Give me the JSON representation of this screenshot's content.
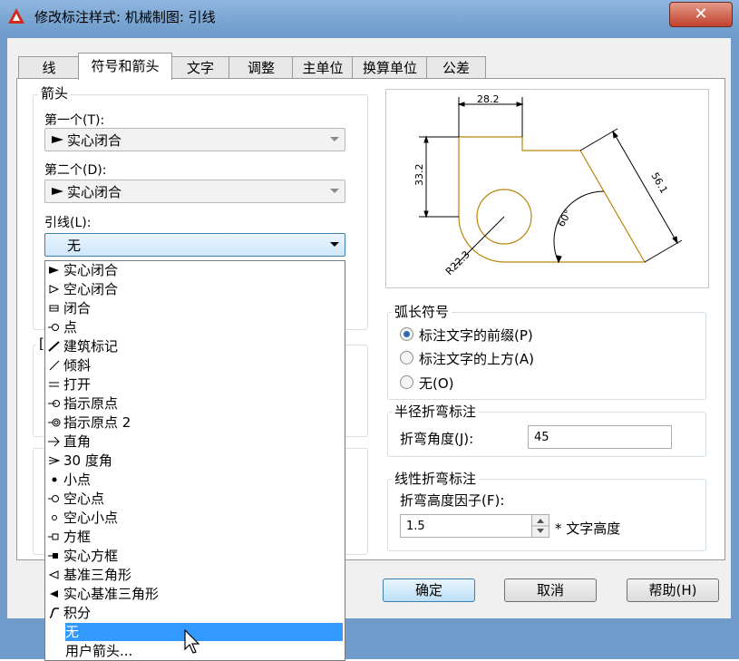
{
  "window": {
    "title": "修改标注样式: 机械制图: 引线",
    "close": "✕"
  },
  "tabs": [
    {
      "label": "线"
    },
    {
      "label": "符号和箭头"
    },
    {
      "label": "文字"
    },
    {
      "label": "调整"
    },
    {
      "label": "主单位"
    },
    {
      "label": "换算单位"
    },
    {
      "label": "公差"
    }
  ],
  "active_tab": "符号和箭头",
  "arrows": {
    "group_label": "箭头",
    "first_label": "第一个(T):",
    "first_value": "实心闭合",
    "second_label": "第二个(D):",
    "second_value": "实心闭合",
    "leader_label": "引线(L):",
    "leader_value": "无"
  },
  "dropdown": {
    "items": [
      {
        "label": "实心闭合",
        "icon": "solid-closed-arrow-icon"
      },
      {
        "label": "空心闭合",
        "icon": "hollow-closed-arrow-icon"
      },
      {
        "label": "闭合",
        "icon": "closed-arrow-icon"
      },
      {
        "label": "点",
        "icon": "dot-icon"
      },
      {
        "label": "建筑标记",
        "icon": "architectural-tick-icon"
      },
      {
        "label": "倾斜",
        "icon": "oblique-icon"
      },
      {
        "label": "打开",
        "icon": "open-arrow-icon"
      },
      {
        "label": "指示原点",
        "icon": "origin-indicator-icon"
      },
      {
        "label": "指示原点 2",
        "icon": "origin-indicator-2-icon"
      },
      {
        "label": "直角",
        "icon": "right-angle-icon"
      },
      {
        "label": "30 度角",
        "icon": "open-30-icon"
      },
      {
        "label": "小点",
        "icon": "small-dot-icon"
      },
      {
        "label": "空心点",
        "icon": "dot-blank-icon"
      },
      {
        "label": "空心小点",
        "icon": "dot-small-blank-icon"
      },
      {
        "label": "方框",
        "icon": "box-blank-icon"
      },
      {
        "label": "实心方框",
        "icon": "box-filled-icon"
      },
      {
        "label": "基准三角形",
        "icon": "datum-triangle-icon"
      },
      {
        "label": "实心基准三角形",
        "icon": "datum-triangle-filled-icon"
      },
      {
        "label": "积分",
        "icon": "integral-icon"
      },
      {
        "label": "无",
        "icon": ""
      },
      {
        "label": "用户箭头...",
        "icon": ""
      }
    ],
    "selected": "无"
  },
  "preview": {
    "dim_top": "28.2",
    "dim_left": "33.2",
    "dim_diag": "56.1",
    "dim_angle": "60°",
    "dim_radius": "R22.3"
  },
  "arc_symbol": {
    "group_label": "弧长符号",
    "options": [
      {
        "label": "标注文字的前缀(P)",
        "checked": true
      },
      {
        "label": "标注文字的上方(A)",
        "checked": false
      },
      {
        "label": "无(O)",
        "checked": false
      }
    ]
  },
  "radius_jog": {
    "group_label": "半径折弯标注",
    "angle_label": "折弯角度(J):",
    "angle_value": "45"
  },
  "linear_jog": {
    "group_label": "线性折弯标注",
    "factor_label": "折弯高度因子(F):",
    "factor_value": "1.5",
    "suffix": "* 文字高度"
  },
  "buttons": {
    "ok": "确定",
    "cancel": "取消",
    "help": "帮助(H)"
  },
  "colors": {
    "preview_lines": "#b8860b",
    "selection": "#3399ff",
    "title_bg": "#7ea8d6"
  }
}
